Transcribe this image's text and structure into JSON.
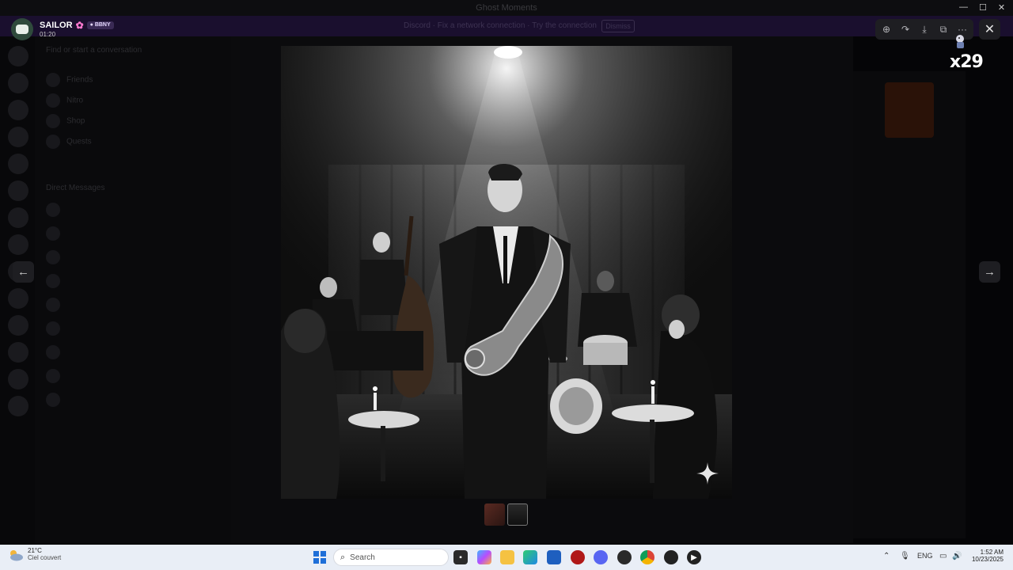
{
  "window": {
    "title": "Ghost Moments"
  },
  "banner": {
    "text": "Discord · Fix a network connection · Try the connection",
    "button": "Dismiss"
  },
  "sidebar": {
    "items": [
      "Find or start a conversation",
      "Friends",
      "Nitro",
      "Shop",
      "Quests",
      "Direct Messages"
    ]
  },
  "viewer": {
    "user": {
      "name": "SAILOR",
      "badge": "BBNY",
      "time": "01:20"
    },
    "counter": "x29",
    "nav": {
      "prev": "←",
      "next": "→"
    },
    "toolbar": {
      "zoom": "⊕",
      "forward": "↷",
      "download": "⤓",
      "open": "⧉",
      "more": "···",
      "close": "✕"
    }
  },
  "photo": {
    "description_icon": "jazz-club-photo"
  },
  "taskbar": {
    "weather": {
      "temp": "21°C",
      "desc": "Ciel couvert"
    },
    "search_placeholder": "Search",
    "lang": "ENG",
    "time": "1:52 AM",
    "date": "10/23/2025"
  },
  "colors": {
    "accent": "#1f6fd8",
    "banner": "#1a0f2e",
    "badge": "#3a2a55"
  }
}
